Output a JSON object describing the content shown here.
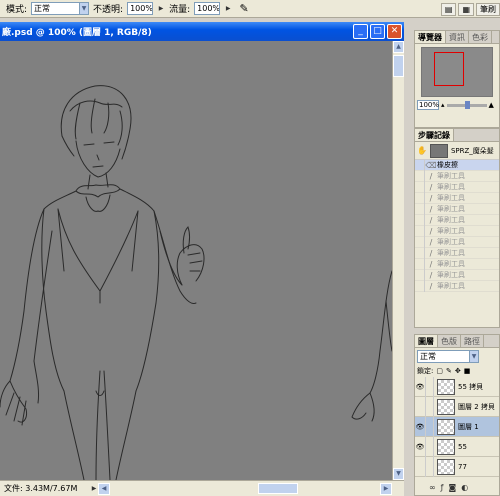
{
  "options_bar": {
    "mode_label": "模式:",
    "mode_value": "正常",
    "opacity_label": "不透明:",
    "opacity_value": "100%",
    "flow_label": "流量:",
    "flow_value": "100%",
    "tabs": [
      "筆刷"
    ]
  },
  "document": {
    "title": "廠.psd @ 100% (圖層 1, RGB/8)",
    "status": "文件: 3.43M/7.67M"
  },
  "navigator": {
    "tabs": [
      "導覽器",
      "資訊",
      "色彩"
    ],
    "zoom": "100%"
  },
  "history": {
    "tab": "步驟記錄",
    "snapshot_name": "SPRZ_魔朵髮",
    "items": [
      {
        "label": "橡皮擦",
        "selected": true
      },
      {
        "label": "筆刷工具",
        "selected": false
      },
      {
        "label": "筆刷工具",
        "selected": false
      },
      {
        "label": "筆刷工具",
        "selected": false
      },
      {
        "label": "筆刷工具",
        "selected": false
      },
      {
        "label": "筆刷工具",
        "selected": false
      },
      {
        "label": "筆刷工具",
        "selected": false
      },
      {
        "label": "筆刷工具",
        "selected": false
      },
      {
        "label": "筆刷工具",
        "selected": false
      },
      {
        "label": "筆刷工具",
        "selected": false
      },
      {
        "label": "筆刷工具",
        "selected": false
      },
      {
        "label": "筆刷工具",
        "selected": false
      }
    ]
  },
  "layers": {
    "tabs": [
      "圖層",
      "色版",
      "路徑"
    ],
    "blend_mode": "正常",
    "lock_label": "鎖定:",
    "items": [
      {
        "name": "55 拷貝",
        "visible": true
      },
      {
        "name": "圖層 2 拷貝",
        "visible": false
      },
      {
        "name": "圖層 1",
        "visible": true,
        "active": true
      },
      {
        "name": "55",
        "visible": true
      },
      {
        "name": "77",
        "visible": false
      }
    ]
  },
  "colors": {
    "title_bar": "#0054e3",
    "canvas": "#808080",
    "panel": "#ece9d8"
  }
}
